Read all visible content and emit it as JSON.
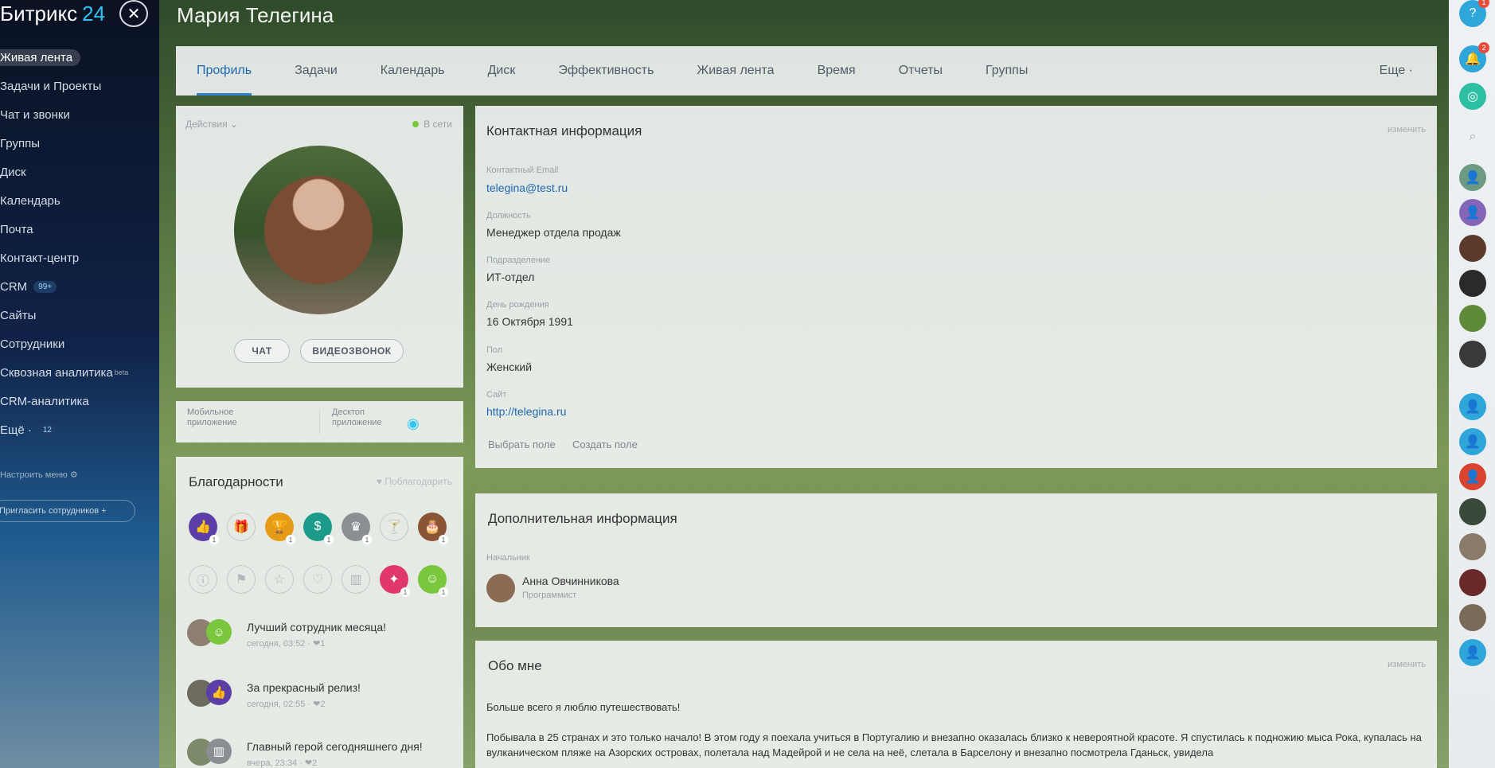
{
  "brand": {
    "name": "Битрикс",
    "number": "24"
  },
  "left_menu": {
    "items": [
      {
        "label": "Живая лента",
        "active": true
      },
      {
        "label": "Задачи и Проекты"
      },
      {
        "label": "Чат и звонки"
      },
      {
        "label": "Группы"
      },
      {
        "label": "Диск"
      },
      {
        "label": "Календарь"
      },
      {
        "label": "Почта"
      },
      {
        "label": "Контакт-центр"
      },
      {
        "label": "CRM",
        "badge": "99+"
      },
      {
        "label": "Сайты"
      },
      {
        "label": "Сотрудники"
      },
      {
        "label": "Сквозная аналитика",
        "beta": "beta"
      },
      {
        "label": "CRM-аналитика"
      },
      {
        "label": "Ещё ·",
        "badge": "12"
      }
    ],
    "settings": "Настроить меню",
    "invite": "Пригласить сотрудников"
  },
  "page_title": "Мария Телегина",
  "tabs": [
    "Профиль",
    "Задачи",
    "Календарь",
    "Диск",
    "Эффективность",
    "Живая лента",
    "Время",
    "Отчеты",
    "Группы"
  ],
  "tabs_more": "Еще ·",
  "profile": {
    "actions": "Действия ⌄",
    "status": "В сети",
    "chat_button": "ЧАТ",
    "video_button": "ВИДЕОЗВОНОК"
  },
  "apps": {
    "mobile_line1": "Мобильное",
    "mobile_line2": "приложение",
    "desktop_line1": "Десктоп",
    "desktop_line2": "приложение"
  },
  "thanks": {
    "title": "Благодарности",
    "give": "Поблагодарить",
    "items": [
      {
        "text": "Лучший сотрудник месяца!",
        "date": "сегодня, 03:52 · ❤1"
      },
      {
        "text": "За прекрасный релиз!",
        "date": "сегодня, 02:55 · ❤2"
      },
      {
        "text": "Главный герой сегодняшнего дня!",
        "date": "вчера, 23:34 · ❤2"
      }
    ]
  },
  "contact": {
    "title": "Контактная информация",
    "edit": "изменить",
    "fields": [
      {
        "label": "Контактный Email",
        "value": "telegina@test.ru",
        "link": true
      },
      {
        "label": "Должность",
        "value": "Менеджер отдела продаж"
      },
      {
        "label": "Подразделение",
        "value": "ИТ-отдел"
      },
      {
        "label": "День рождения",
        "value": "16 Октября 1991"
      },
      {
        "label": "Пол",
        "value": "Женский"
      },
      {
        "label": "Сайт",
        "value": "http://telegina.ru",
        "link": true
      }
    ],
    "choose_field": "Выбрать поле",
    "create_field": "Создать поле"
  },
  "additional": {
    "title": "Дополнительная информация",
    "manager_label": "Начальник",
    "manager_name": "Анна Овчинникова",
    "manager_role": "Программист"
  },
  "about": {
    "title": "Обо мне",
    "edit": "изменить",
    "p1": "Больше всего я люблю путешествовать!",
    "p2": "Побывала в 25 странах и это только начало! В этом году я поехала учиться в Португалию и внезапно оказалась близко к невероятной красоте. Я спустилась к подножию мыса Рока, купалась на вулканическом пляже на Азорских островах, полетала над Мадейрой и не села на неё, слетала в Барселону и внезапно посмотрела Гданьск, увидела"
  },
  "colors": {
    "accent": "#2f82c7",
    "online": "#7ac63d"
  }
}
